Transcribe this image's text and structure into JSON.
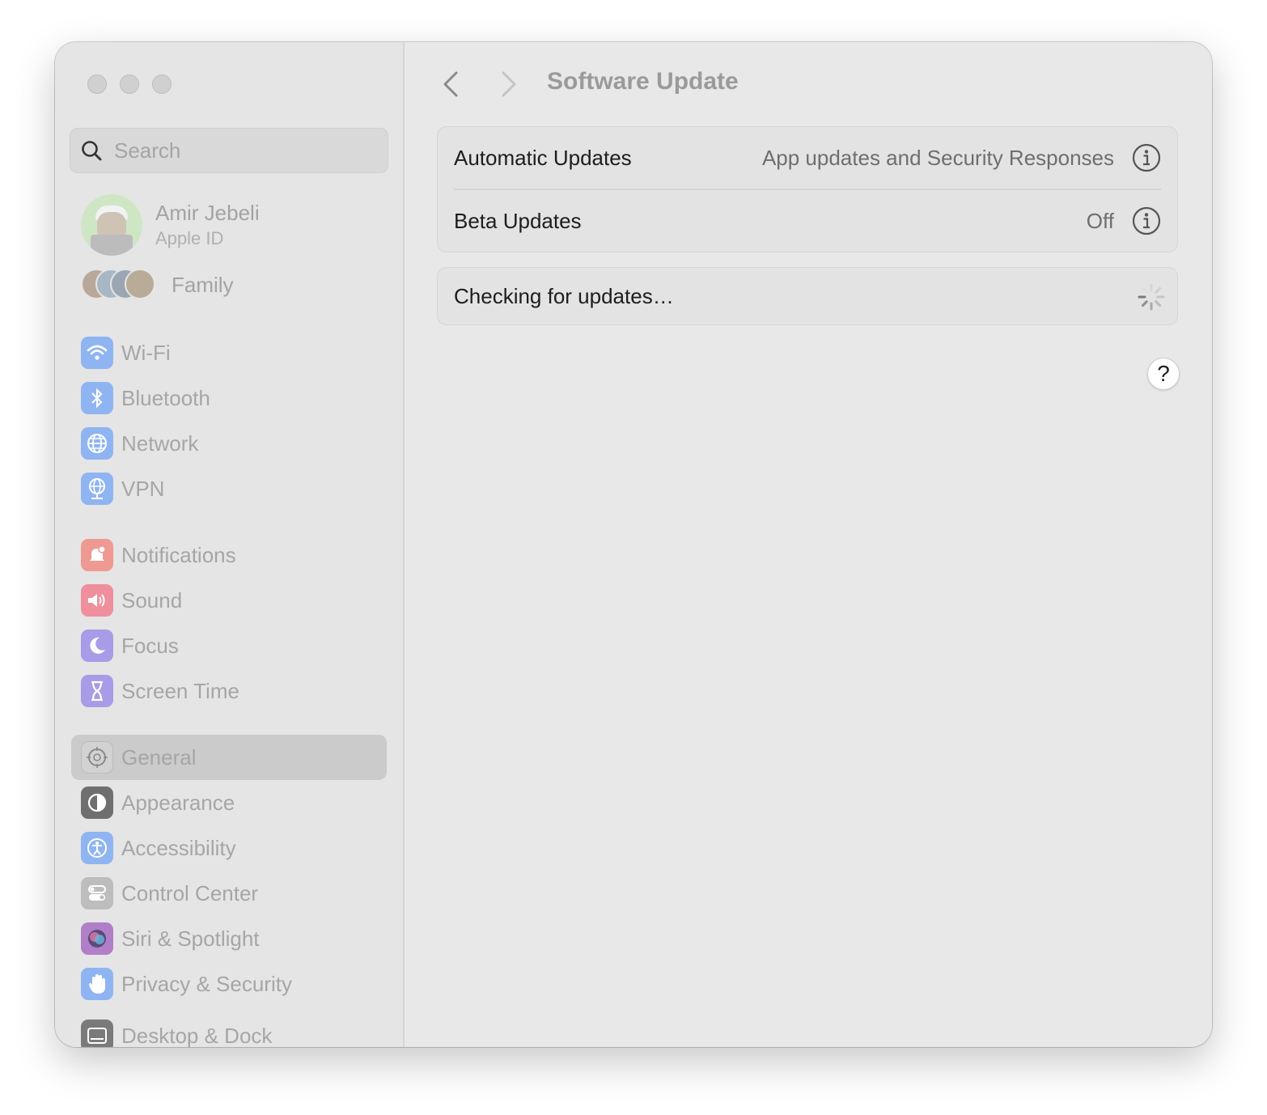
{
  "window": {
    "title": "Software Update"
  },
  "search": {
    "placeholder": "Search"
  },
  "profile": {
    "name": "Amir Jebeli",
    "subtitle": "Apple ID"
  },
  "family": {
    "label": "Family"
  },
  "sidebar": {
    "groups": [
      [
        {
          "label": "Wi-Fi",
          "icon": "wifi-icon",
          "color": "#8fb4f2"
        },
        {
          "label": "Bluetooth",
          "icon": "bluetooth-icon",
          "color": "#8fb4f2"
        },
        {
          "label": "Network",
          "icon": "globe-icon",
          "color": "#8fb4f2"
        },
        {
          "label": "VPN",
          "icon": "vpn-globe-icon",
          "color": "#8fb4f2"
        }
      ],
      [
        {
          "label": "Notifications",
          "icon": "bell-icon",
          "color": "#ee9a92"
        },
        {
          "label": "Sound",
          "icon": "speaker-icon",
          "color": "#ef8f9d"
        },
        {
          "label": "Focus",
          "icon": "moon-icon",
          "color": "#a89be8"
        },
        {
          "label": "Screen Time",
          "icon": "hourglass-icon",
          "color": "#a89be8"
        }
      ],
      [
        {
          "label": "General",
          "icon": "gear-icon",
          "color": "#b9b9b9",
          "active": true
        },
        {
          "label": "Appearance",
          "icon": "appearance-icon",
          "color": "#6f6f6f"
        },
        {
          "label": "Accessibility",
          "icon": "accessibility-icon",
          "color": "#8fb4f2"
        },
        {
          "label": "Control Center",
          "icon": "toggles-icon",
          "color": "#bdbdbd"
        },
        {
          "label": "Siri & Spotlight",
          "icon": "siri-icon",
          "color": "#b07fc8"
        },
        {
          "label": "Privacy & Security",
          "icon": "hand-icon",
          "color": "#8fb4f2"
        }
      ],
      [
        {
          "label": "Desktop & Dock",
          "icon": "dock-icon",
          "color": "#7a7a7a"
        }
      ]
    ]
  },
  "settings": {
    "automatic_updates": {
      "label": "Automatic Updates",
      "value": "App updates and Security Responses"
    },
    "beta_updates": {
      "label": "Beta Updates",
      "value": "Off"
    },
    "status": {
      "label": "Checking for updates…"
    },
    "help_label": "?"
  }
}
